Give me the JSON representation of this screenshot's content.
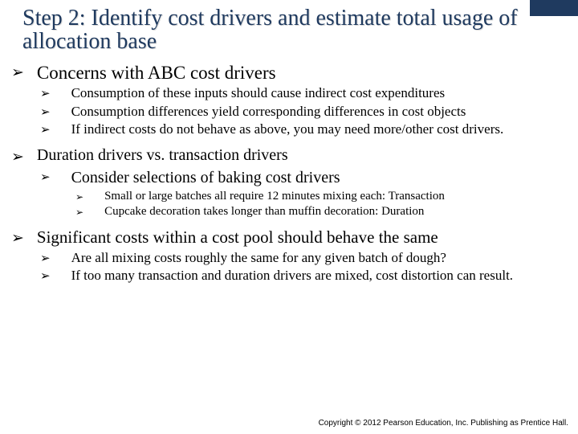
{
  "title": "Step 2: Identify cost drivers and estimate total usage of allocation base",
  "s1": {
    "heading": "Concerns with ABC cost drivers",
    "p1": "Consumption of these inputs should cause indirect cost expenditures",
    "p2": "Consumption differences yield corresponding differences in cost objects",
    "p3": "If indirect costs do not behave as above, you may need more/other cost drivers."
  },
  "s2": {
    "heading": "Duration drivers vs. transaction drivers",
    "sub": "Consider selections of baking cost drivers",
    "p1": "Small or large batches all require 12 minutes mixing each: Transaction",
    "p2": "Cupcake decoration takes longer than muffin decoration: Duration"
  },
  "s3": {
    "heading": "Significant costs within a cost pool should behave the same",
    "p1": "Are all mixing costs roughly the same for any given batch of dough?",
    "p2": "If too many transaction and duration drivers are mixed, cost distortion can result."
  },
  "footer": "Copyright © 2012 Pearson Education, Inc. Publishing as Prentice Hall."
}
